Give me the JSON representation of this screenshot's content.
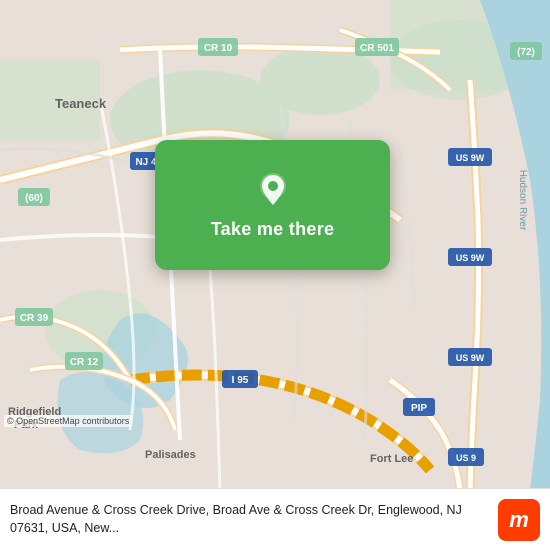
{
  "map": {
    "attribution": "© OpenStreetMap contributors",
    "button": {
      "label": "Take me there"
    },
    "colors": {
      "map_bg": "#e8e0d8",
      "water": "#aad3df",
      "green_area": "#c8dfc8",
      "road_major": "#f7d39b",
      "road_minor": "#ffffff",
      "overlay_green": "#4CAF50"
    },
    "labels": {
      "teaneck": "Teaneck",
      "ridgefield_park": "Ridgefield Park",
      "palisades": "Palisades",
      "fort_lee": "Fort Lee",
      "hudson_river": "Hudson River",
      "cr10": "CR 10",
      "cr501": "CR 501",
      "nj4": "NJ 4",
      "cr60": "(60)",
      "cr39": "CR 39",
      "cr12": "CR 12",
      "i95": "I 95",
      "pip": "PIP",
      "us9w_1": "US 9W",
      "us9w_2": "US 9W",
      "us9w_3": "US 9W",
      "us9": "US 9",
      "n72": "(72)"
    }
  },
  "bottom_bar": {
    "description": "Broad Avenue & Cross Creek Drive, Broad Ave & Cross Creek Dr, Englewood, NJ 07631, USA, New..."
  }
}
